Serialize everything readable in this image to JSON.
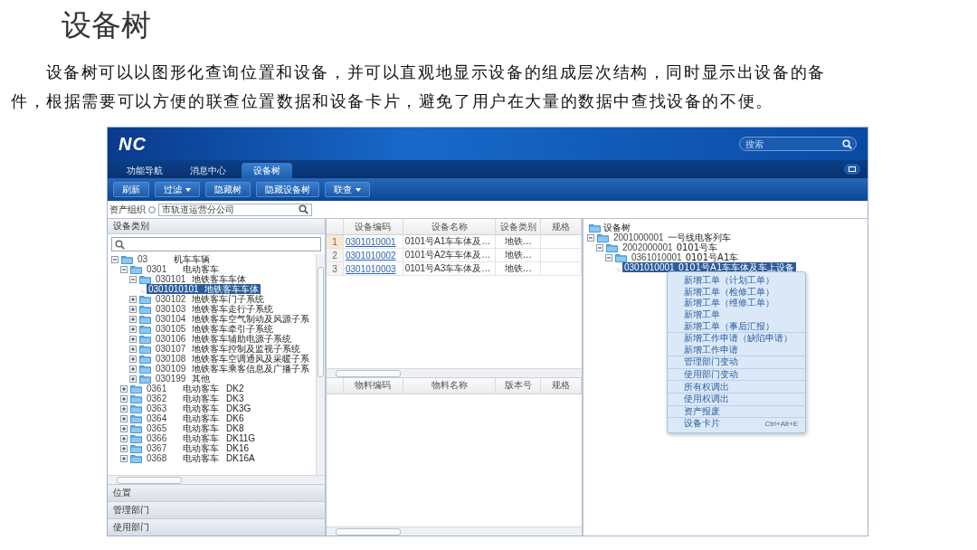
{
  "heading": "设备树",
  "paragraph": "设备树可以以图形化查询位置和设备，并可以直观地显示设备的组成层次结构，同时显示出设备的备件，根据需要可以方便的联查位置数据和设备卡片，避免了用户在大量的数据中查找设备的不便。",
  "app": {
    "logo": "NC",
    "search": {
      "placeholder": "搜索"
    },
    "tabs": [
      {
        "label": "功能导航",
        "selected": false
      },
      {
        "label": "消息中心",
        "selected": false
      },
      {
        "label": "设备树",
        "selected": true
      }
    ],
    "toolbar": [
      {
        "label": "刷新",
        "kind": "plain"
      },
      {
        "label": "过滤",
        "kind": "dropdown"
      },
      {
        "label": "隐藏树",
        "kind": "plain"
      },
      {
        "label": "隐藏设备树",
        "kind": "plain"
      },
      {
        "label": "联查",
        "kind": "dropdown"
      }
    ],
    "org": {
      "label": "资产组织",
      "value": "市轨道运营分公司"
    },
    "category_panel": {
      "title": "设备类别",
      "tree": [
        {
          "code": "03",
          "name": "机车车辆",
          "expanded": true,
          "selected": false,
          "children": [
            {
              "code": "0301",
              "name": "电动客车",
              "expanded": true,
              "selected": false,
              "children": [
                {
                  "code": "030101",
                  "name": "地铁客车车体",
                  "expanded": true,
                  "selected": false,
                  "children": [
                    {
                      "code": "0301010101",
                      "name": "地铁客车车体",
                      "selected": true
                    }
                  ]
                },
                {
                  "code": "030102",
                  "name": "地铁客车门子系统",
                  "expanded": false,
                  "selected": false
                },
                {
                  "code": "030103",
                  "name": "地铁客车走行子系统",
                  "expanded": false,
                  "selected": false
                },
                {
                  "code": "030104",
                  "name": "地铁客车空气制动及风源子系",
                  "expanded": false,
                  "selected": false
                },
                {
                  "code": "030105",
                  "name": "地铁客车牵引子系统",
                  "expanded": false,
                  "selected": false
                },
                {
                  "code": "030106",
                  "name": "地铁客车辅助电源子系统",
                  "expanded": false,
                  "selected": false
                },
                {
                  "code": "030107",
                  "name": "地铁客车控制及监视子系统",
                  "expanded": false,
                  "selected": false
                },
                {
                  "code": "030108",
                  "name": "地铁客车空调通风及采暖子系",
                  "expanded": false,
                  "selected": false
                },
                {
                  "code": "030109",
                  "name": "地铁客车乘客信息及广播子系",
                  "expanded": false,
                  "selected": false
                },
                {
                  "code": "030199",
                  "name": "其他",
                  "expanded": false,
                  "selected": false
                }
              ]
            },
            {
              "code": "0361",
              "name": "电动客车",
              "model": "DK2",
              "expanded": false,
              "selected": false
            },
            {
              "code": "0362",
              "name": "电动客车",
              "model": "DK3",
              "expanded": false,
              "selected": false
            },
            {
              "code": "0363",
              "name": "电动客车",
              "model": "DK3G",
              "expanded": false,
              "selected": false
            },
            {
              "code": "0364",
              "name": "电动客车",
              "model": "DK6",
              "expanded": false,
              "selected": false
            },
            {
              "code": "0365",
              "name": "电动客车",
              "model": "DK8",
              "expanded": false,
              "selected": false
            },
            {
              "code": "0366",
              "name": "电动客车",
              "model": "DK11G",
              "expanded": false,
              "selected": false
            },
            {
              "code": "0367",
              "name": "电动客车",
              "model": "DK16",
              "expanded": false,
              "selected": false
            },
            {
              "code": "0368",
              "name": "电动客车",
              "model": "DK16A",
              "expanded": false,
              "selected": false
            }
          ]
        }
      ],
      "sections": [
        "位置",
        "管理部门",
        "使用部门"
      ]
    },
    "equipment_table": {
      "columns": [
        "设备编码",
        "设备名称",
        "设备类别",
        "规格"
      ],
      "rows": [
        {
          "number": "1",
          "code": "0301010001",
          "name": "0101号A1车车体及…",
          "category": "地铁…",
          "selected": true
        },
        {
          "number": "2",
          "code": "0301010002",
          "name": "0101号A2车车体及…",
          "category": "地铁…",
          "selected": false
        },
        {
          "number": "3",
          "code": "0301010003",
          "name": "0101号A3车车体及…",
          "category": "地铁…",
          "selected": false
        }
      ]
    },
    "material_table": {
      "columns": [
        "物料编码",
        "物料名称",
        "版本号",
        "规格"
      ]
    },
    "device_tree": {
      "root": "设备树",
      "tree": [
        {
          "code": "2001000001",
          "name": "一号线电客列车",
          "expanded": true,
          "selected": false,
          "children": [
            {
              "code": "2002000001",
              "name": "0101号车",
              "expanded": true,
              "selected": false,
              "children": [
                {
                  "code": "0361010001",
                  "name": "0101号A1车",
                  "expanded": true,
                  "selected": false,
                  "children": [
                    {
                      "code": "0301010001",
                      "name": "0101号A1车车体及车上设备",
                      "selected": true
                    }
                  ]
                }
              ]
            }
          ]
        }
      ]
    },
    "context_menu": {
      "groups": [
        {
          "items": [
            {
              "label": "新增工单（计划工单）"
            },
            {
              "label": "新增工单（检修工单）"
            },
            {
              "label": "新增工单（维修工单）"
            },
            {
              "label": "新增工单"
            },
            {
              "label": "新增工单（事后汇报）"
            }
          ]
        },
        {
          "items": [
            {
              "label": "新增工作申请（缺陷申请）"
            },
            {
              "label": "新增工作申请"
            }
          ]
        },
        {
          "items": [
            {
              "label": "管理部门变动"
            }
          ]
        },
        {
          "items": [
            {
              "label": "使用部门变动"
            }
          ]
        },
        {
          "items": [
            {
              "label": "所有权调出"
            }
          ]
        },
        {
          "items": [
            {
              "label": "使用权调出"
            }
          ]
        },
        {
          "items": [
            {
              "label": "资产报废"
            }
          ]
        },
        {
          "items": [
            {
              "label": "设备卡片",
              "shortcut": "Ctrl+Alt+E"
            }
          ]
        }
      ]
    }
  }
}
